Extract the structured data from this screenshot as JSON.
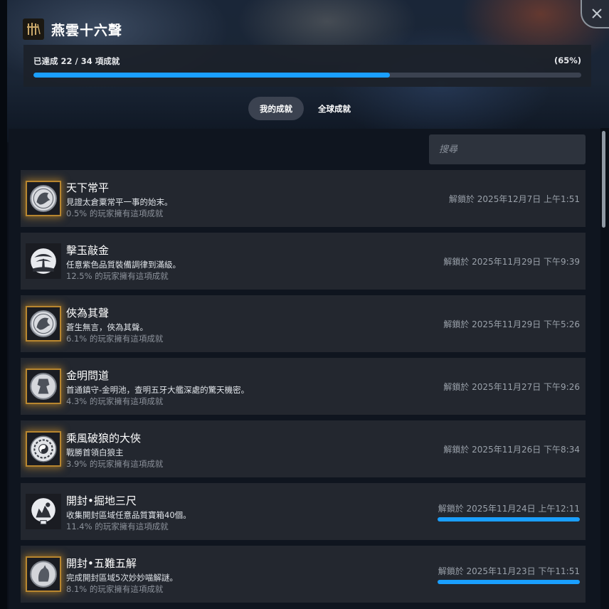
{
  "game": {
    "title": "燕雲十六聲",
    "icon": "game-logo-icon"
  },
  "progress": {
    "label": "已達成 22 / 34 項成就",
    "percent_label": "(65%)",
    "fraction": 0.65
  },
  "tabs": [
    {
      "label": "我的成就",
      "active": true
    },
    {
      "label": "全球成就",
      "active": false
    }
  ],
  "search": {
    "placeholder": "搜尋",
    "value": ""
  },
  "achievements": [
    {
      "name": "天下常平",
      "desc": "見證太倉粟常平一事的始末。",
      "pct": "0.5% 的玩家擁有這項成就",
      "date": "解鎖於 2025年12月7日 上午1:51",
      "rare": true,
      "icon": "dragon-badge-icon",
      "has_bar": false
    },
    {
      "name": "擊玉敲金",
      "desc": "任意紫色品質裝備調律到滿級。",
      "pct": "12.5% 的玩家擁有這項成就",
      "date": "解鎖於 2025年11月29日 下午9:39",
      "rare": false,
      "icon": "pine-tree-badge-icon",
      "has_bar": false
    },
    {
      "name": "俠為其聲",
      "desc": "蒼生無言，俠為其聲。",
      "pct": "6.1% 的玩家擁有這項成就",
      "date": "解鎖於 2025年11月29日 下午5:26",
      "rare": true,
      "icon": "dragon-badge-icon",
      "has_bar": false
    },
    {
      "name": "金明問道",
      "desc": "首通鎮守-金明池，查明五牙大艦深處的驚天機密。",
      "pct": "4.3% 的玩家擁有這項成就",
      "date": "解鎖於 2025年11月27日 下午9:26",
      "rare": true,
      "icon": "warrior-badge-icon",
      "has_bar": false
    },
    {
      "name": "乘風破狼的大俠",
      "desc": "戰勝首領白狼主",
      "pct": "3.9% 的玩家擁有這項成就",
      "date": "解鎖於 2025年11月26日 下午8:34",
      "rare": true,
      "icon": "yin-yang-badge-icon",
      "has_bar": false
    },
    {
      "name": "開封•掘地三尺",
      "desc": "收集開封區域任意品質寶箱40個。",
      "pct": "11.4% 的玩家擁有這項成就",
      "date": "解鎖於 2025年11月24日 上午12:11",
      "rare": false,
      "icon": "treasure-badge-icon",
      "has_bar": true,
      "bar_fraction": 1.0
    },
    {
      "name": "開封•五難五解",
      "desc": "完成開封區域5次妙妙喵解謎。",
      "pct": "8.1% 的玩家擁有這項成就",
      "date": "解鎖於 2025年11月23日 下午11:51",
      "rare": true,
      "icon": "cat-badge-icon",
      "has_bar": true,
      "bar_fraction": 1.0
    }
  ],
  "colors": {
    "accent": "#1a9fff",
    "panel": "#23272f",
    "rare_border": "#b8862f"
  }
}
